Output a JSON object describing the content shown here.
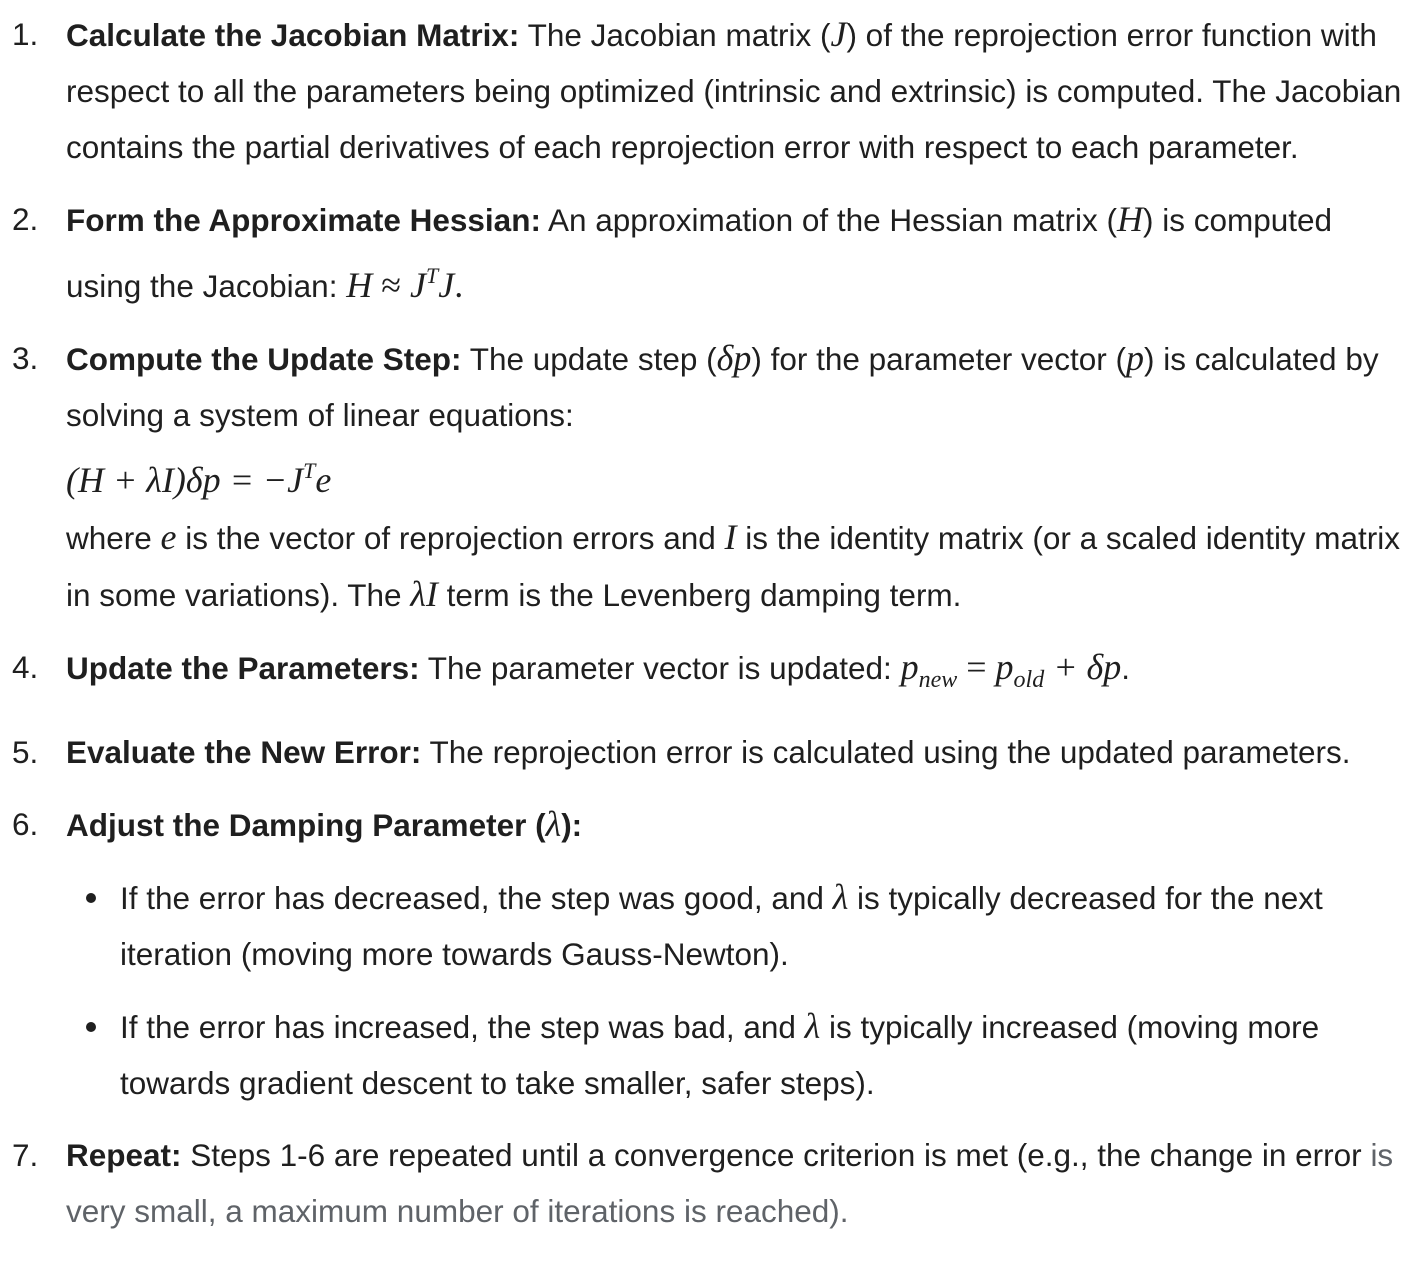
{
  "steps": [
    {
      "num": "1.",
      "title": "Calculate the Jacobian Matrix:",
      "t1": " The Jacobian matrix (",
      "m1": "J",
      "t2": ") of the reprojection error function with respect to all the parameters being optimized (intrinsic and extrinsic) is computed. The Jacobian contains the partial derivatives of each reprojection error with respect to each parameter."
    },
    {
      "num": "2.",
      "title": "Form the Approximate Hessian:",
      "t1": " An approximation of the Hessian matrix (",
      "m1": "H",
      "t2": ") is computed using the Jacobian: ",
      "eq_h": "H",
      "eq_approx": " ≈ ",
      "eq_j": "J",
      "eq_sup": "T",
      "eq_j2": "J",
      "eq_end": "."
    },
    {
      "num": "3.",
      "title": "Compute the Update Step:",
      "t1": " The update step (",
      "m1": "δp",
      "t2": ") for the parameter vector (",
      "m2": "p",
      "t3": ") is calculated by solving a system of linear equations:",
      "eq_a": "(H + λI)δp = −J",
      "eq_sup": "T",
      "eq_b": "e",
      "t4": "where ",
      "m3": "e",
      "t5": " is the vector of reprojection errors and ",
      "m4": "I",
      "t6": " is the identity matrix (or a scaled identity matrix in some variations). The ",
      "m5": "λI",
      "t7": " term is the Levenberg damping term."
    },
    {
      "num": "4.",
      "title": "Update the Parameters:",
      "t1": " The parameter vector is updated: ",
      "m_p1": "p",
      "sub1": "new",
      "eq_mid": " = ",
      "m_p2": "p",
      "sub2": "old",
      "eq_tail": " + δp",
      "end": "."
    },
    {
      "num": "5.",
      "title": "Evaluate the New Error:",
      "t1": " The reprojection error is calculated using the updated parameters."
    },
    {
      "num": "6.",
      "title_a": "Adjust the Damping Parameter (",
      "title_m": "λ",
      "title_b": "):",
      "bullets": [
        {
          "a": "If the error has decreased, the step was good, and ",
          "m": "λ",
          "b": " is typically decreased for the next iteration (moving more towards Gauss-Newton)."
        },
        {
          "a": "If the error has increased, the step was bad, and ",
          "m": "λ",
          "b": " is typically increased (moving more towards gradient descent to take smaller, safer steps)."
        }
      ]
    },
    {
      "num": "7.",
      "title": "Repeat:",
      "t1": " Steps 1-6 are repeated until a convergence criterion is met (e.g., the change in error ",
      "t2": "is very small, a maximum number of iterations is reached)."
    }
  ]
}
